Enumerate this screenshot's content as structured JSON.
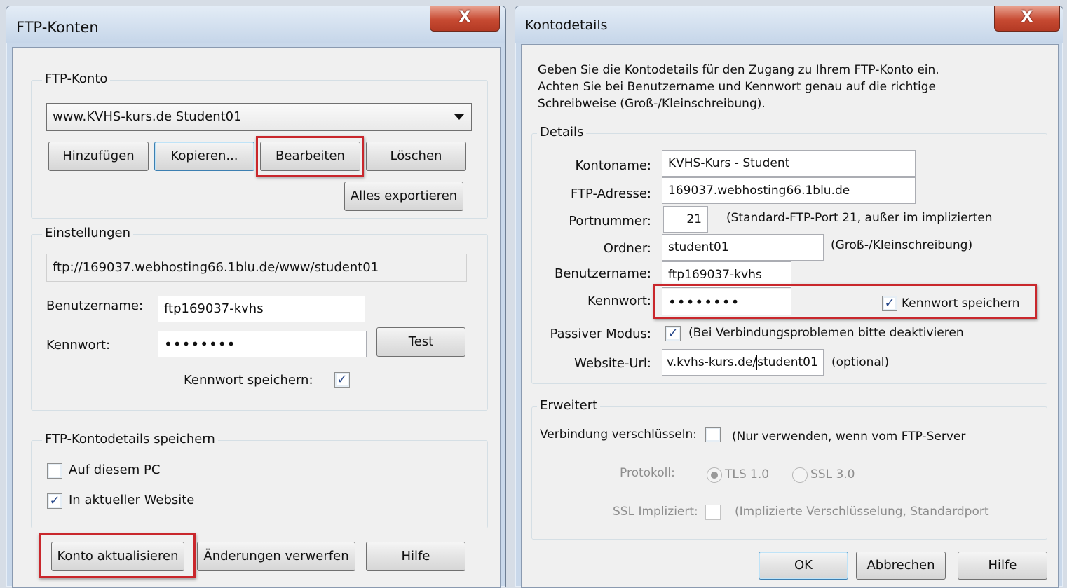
{
  "ftp_konten": {
    "title": "FTP-Konten",
    "close_label": "X",
    "konto_group": "FTP-Konto",
    "selected_account": "www.KVHS-kurs.de Student01",
    "buttons": {
      "add": "Hinzufügen",
      "copy": "Kopieren...",
      "edit": "Bearbeiten",
      "delete": "Löschen",
      "export_all": "Alles exportieren"
    },
    "settings_group": "Einstellungen",
    "url": "ftp://169037.webhosting66.1blu.de/www/student01",
    "username_label": "Benutzername:",
    "username": "ftp169037-kvhs",
    "password_label": "Kennwort:",
    "password": "••••••••",
    "test_button": "Test",
    "save_password_label": "Kennwort speichern:",
    "save_password_checked": true,
    "save_group": "FTP-Kontodetails speichern",
    "on_this_pc": "Auf diesem PC",
    "on_this_pc_checked": false,
    "in_website": "In aktueller Website",
    "in_website_checked": true,
    "update_button": "Konto aktualisieren",
    "discard_button": "Änderungen verwerfen",
    "help_button": "Hilfe"
  },
  "kontodetails": {
    "title": "Kontodetails",
    "close_label": "X",
    "intro_line1": "Geben Sie die Kontodetails für den Zugang zu Ihrem FTP-Konto ein.",
    "intro_line2": "Achten Sie bei Benutzername und Kennwort genau auf die richtige",
    "intro_line3": "Schreibweise (Groß-/Kleinschreibung).",
    "details_group": "Details",
    "account_name_label": "Kontoname:",
    "account_name": "KVHS-Kurs - Student",
    "ftp_address_label": "FTP-Adresse:",
    "ftp_address": "169037.webhosting66.1blu.de",
    "port_label": "Portnummer:",
    "port": "21",
    "port_hint": "(Standard-FTP-Port 21, außer im implizierten",
    "folder_label": "Ordner:",
    "folder": "student01",
    "folder_hint": "(Groß-/Kleinschreibung)",
    "username_label": "Benutzername:",
    "username": "ftp169037-kvhs",
    "password_label": "Kennwort:",
    "password": "••••••••",
    "save_password_label": "Kennwort speichern",
    "save_password_checked": true,
    "passive_label": "Passiver Modus:",
    "passive_checked": true,
    "passive_hint": "(Bei Verbindungsproblemen bitte deaktivieren",
    "website_url_label": "Website-Url:",
    "website_url_before_caret": "v.kvhs-kurs.de/",
    "website_url_after_caret": "student01",
    "website_url_hint": "(optional)",
    "advanced_group": "Erweitert",
    "encrypt_label": "Verbindung verschlüsseln:",
    "encrypt_checked": false,
    "encrypt_hint": "(Nur verwenden, wenn vom FTP-Server",
    "protocol_label": "Protokoll:",
    "tls": "TLS 1.0",
    "ssl": "SSL 3.0",
    "ssl_implicit_label": "SSL Impliziert:",
    "ssl_implicit_hint": "(Implizierte Verschlüsselung, Standardport",
    "ok_button": "OK",
    "cancel_button": "Abbrechen",
    "help_button": "Hilfe"
  }
}
